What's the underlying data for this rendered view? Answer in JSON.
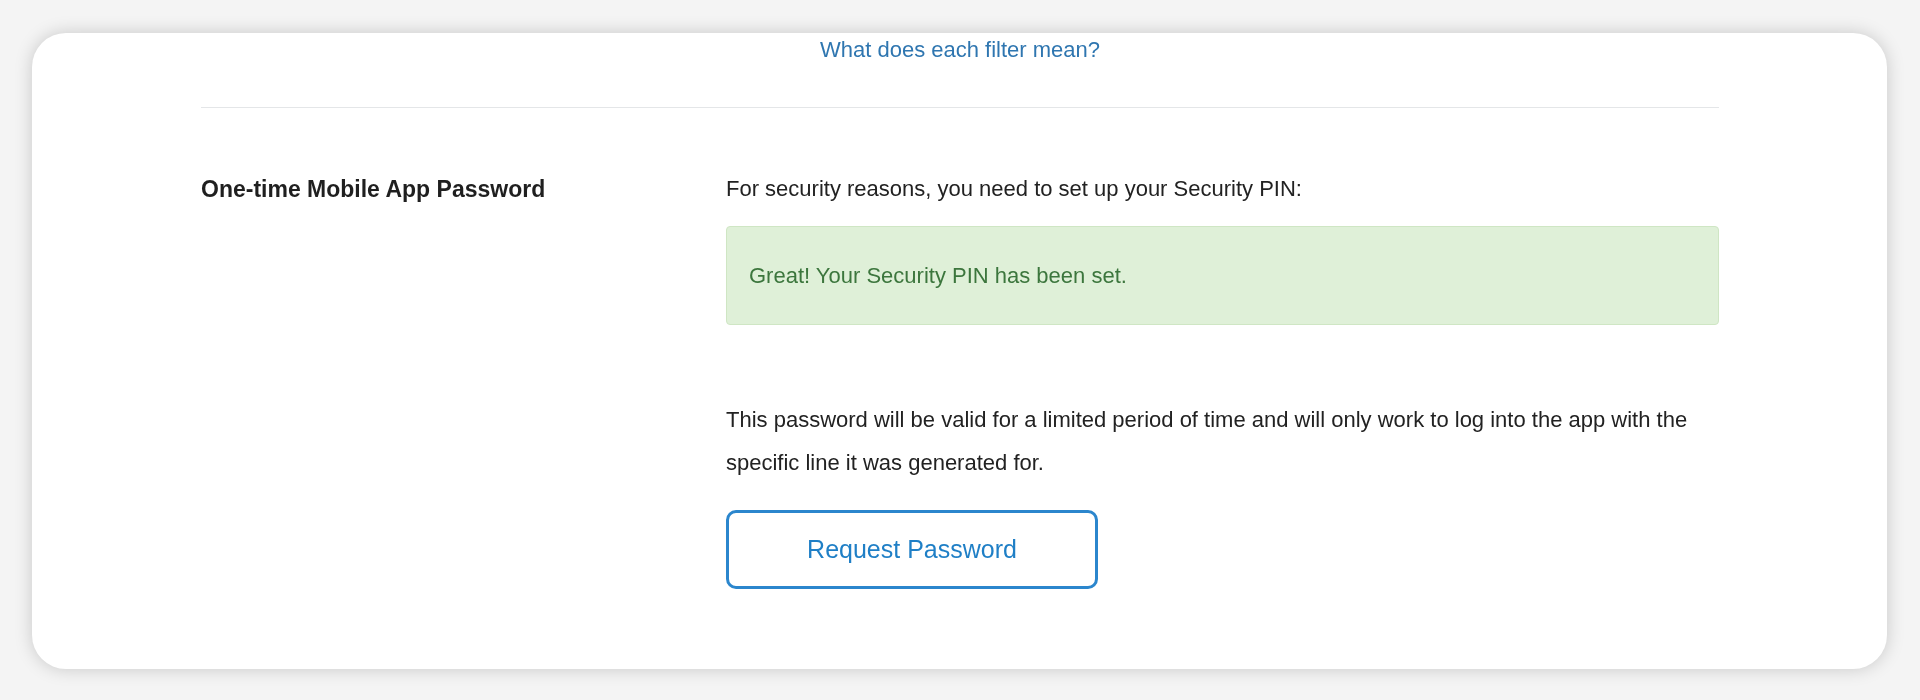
{
  "help_link": "What does each filter mean?",
  "section": {
    "heading": "One-time Mobile App Password",
    "intro": "For security reasons, you need to set up your Security PIN:",
    "alert": {
      "kind": "success",
      "text": "Great! Your Security PIN has been set."
    },
    "description": "This password will be valid for a limited period of time and will only work to log into the app with the specific line it was generated for.",
    "button": "Request Password"
  }
}
